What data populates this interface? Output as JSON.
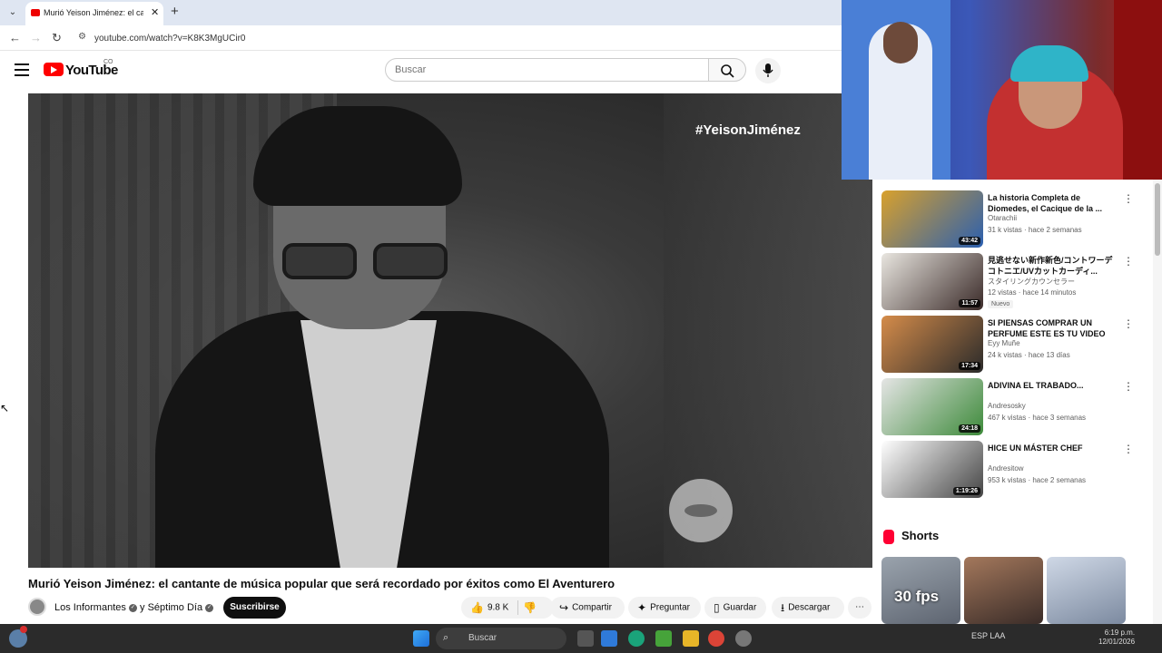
{
  "browser": {
    "tab_title": "Murió Yeison Jiménez: el cantan...",
    "url": "youtube.com/watch?v=K8K3MgUCir0",
    "new_tab_icon": "+",
    "close_icon": "✕"
  },
  "header": {
    "logo_text": "YouTube",
    "country_code": "CO",
    "search_placeholder": "Buscar"
  },
  "player": {
    "hashtag": "#YeisonJiménez"
  },
  "video": {
    "title": "Murió Yeison Jiménez: el cantante de música popular que será recordado por éxitos como El Aventurero",
    "channel": "Los Informantes",
    "collab_joiner": "y",
    "collab_channel": "Séptimo Día",
    "subscribe_label": "Suscribirse",
    "likes": "9.8 K",
    "share_label": "Compartir",
    "ask_label": "Preguntar",
    "save_label": "Guardar",
    "download_label": "Descargar"
  },
  "recommendations": [
    {
      "title": "La historia Completa de Diomedes, el Cacique de la ...",
      "channel": "Otarachii",
      "stats": "31 k vistas · hace 2 semanas",
      "duration": "43:42",
      "thumb_colors": [
        "#d9a12c",
        "#2a5fb0"
      ]
    },
    {
      "title": "見逃せない新作新色/コントワーデコトニエ/UVカットカーディ...",
      "channel": "スタイリングカウンセラー",
      "stats": "12 vistas · hace 14 minutos",
      "duration": "11:57",
      "badge": "Nuevo",
      "thumb_colors": [
        "#e9e6e0",
        "#3a2a28"
      ]
    },
    {
      "title": "SI PIENSAS COMPRAR UN PERFUME ESTE ES TU VIDEO |...",
      "channel": "Eyy Muñe",
      "stats": "24 k vistas · hace 13 días",
      "duration": "17:34",
      "thumb_colors": [
        "#d58c4a",
        "#2a2a2a"
      ]
    },
    {
      "title": "ADIVINA EL TRABADO...",
      "channel": "Andresosky",
      "stats": "467 k vistas · hace 3 semanas",
      "duration": "24:18",
      "thumb_colors": [
        "#e5e5e5",
        "#3d8a3a"
      ]
    },
    {
      "title": "HICE UN MÁSTER CHEF",
      "channel": "Andresitow",
      "stats": "953 k vistas · hace 2 semanas",
      "duration": "1:19:26",
      "thumb_colors": [
        "#ffffff",
        "#444444"
      ]
    }
  ],
  "shorts": {
    "label": "Shorts",
    "items": [
      {
        "overlay_text": "30 fps",
        "colors": [
          "#9aa3ad",
          "#5d6470"
        ]
      },
      {
        "overlay_text": "",
        "colors": [
          "#a4785c",
          "#3a2c28"
        ]
      },
      {
        "overlay_text": "",
        "colors": [
          "#cfd8e6",
          "#7c8aa0"
        ]
      }
    ]
  },
  "taskbar": {
    "search_label": "Buscar",
    "tray_text": "ESP LAA",
    "clock_time": "6:19 p.m.",
    "clock_date": "12/01/2026"
  },
  "colors": {
    "brand_red": "#ff0000",
    "subscribe_bg": "#0f0f0f",
    "taskbar_bg": "#2b2b2b"
  }
}
